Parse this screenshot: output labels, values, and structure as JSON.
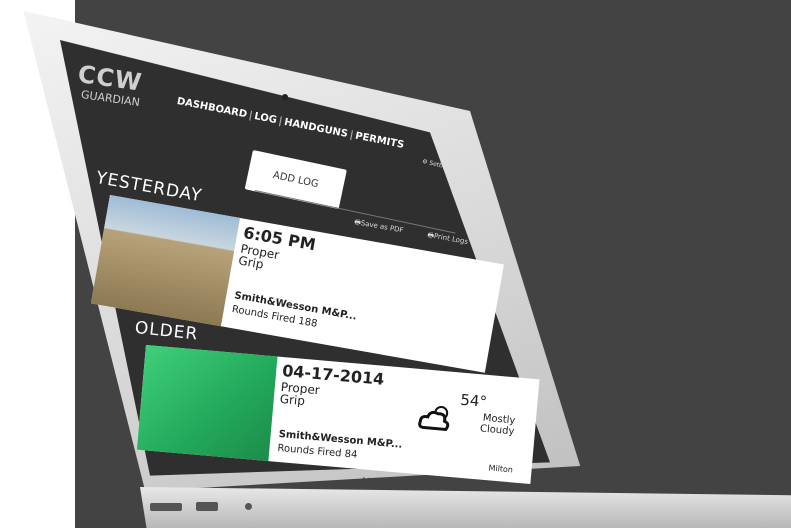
{
  "app": {
    "logo_main": "CCW",
    "logo_sub": "GUARDIAN"
  },
  "nav": {
    "items": [
      "DASHBOARD",
      "LOG",
      "HANDGUNS",
      "PERMITS"
    ],
    "separator": "|",
    "settings_label": "Settings"
  },
  "actions": {
    "add_log": "ADD LOG",
    "save_pdf": "Save as PDF",
    "print_logs": "Print Logs"
  },
  "sections": {
    "yesterday": "YESTERDAY",
    "older": "OLDER"
  },
  "logs": [
    {
      "time": "6:05 PM",
      "grip": [
        "Proper",
        "Grip"
      ],
      "handgun": "Smith&Wesson M&P...",
      "rounds": "Rounds Fired 188"
    },
    {
      "time": "04-17-2014",
      "grip": [
        "Proper",
        "Grip"
      ],
      "handgun": "Smith&Wesson M&P...",
      "rounds": "Rounds Fired 84",
      "temperature": "54°",
      "conditions": [
        "Mostly",
        "Cloudy"
      ],
      "location": "Milton"
    }
  ],
  "device": {
    "model": "MacBook Air"
  },
  "colors": {
    "backdrop": "#434343",
    "screen": "#2f2f2f",
    "card": "#ffffff"
  }
}
